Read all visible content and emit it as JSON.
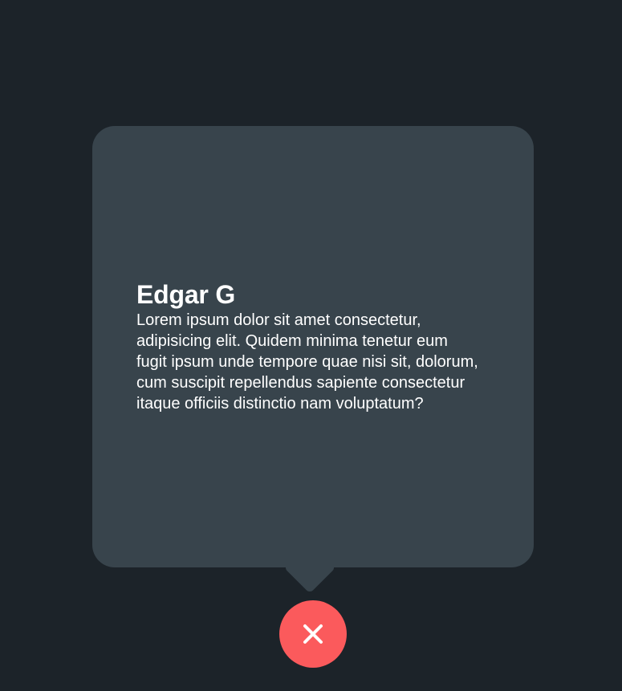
{
  "card": {
    "title": "Edgar G",
    "body": "Lorem ipsum dolor sit amet consectetur, adipisicing elit. Quidem minima tenetur eum fugit ipsum unde tempore quae nisi sit, dolorum, cum suscipit repellendus sapiente consectetur itaque officiis distinctio nam voluptatum?"
  },
  "close_button": {
    "icon": "close-icon",
    "color": "#fb5a5c"
  },
  "colors": {
    "background": "#1c2329",
    "card": "#38444c",
    "text": "#ffffff"
  }
}
